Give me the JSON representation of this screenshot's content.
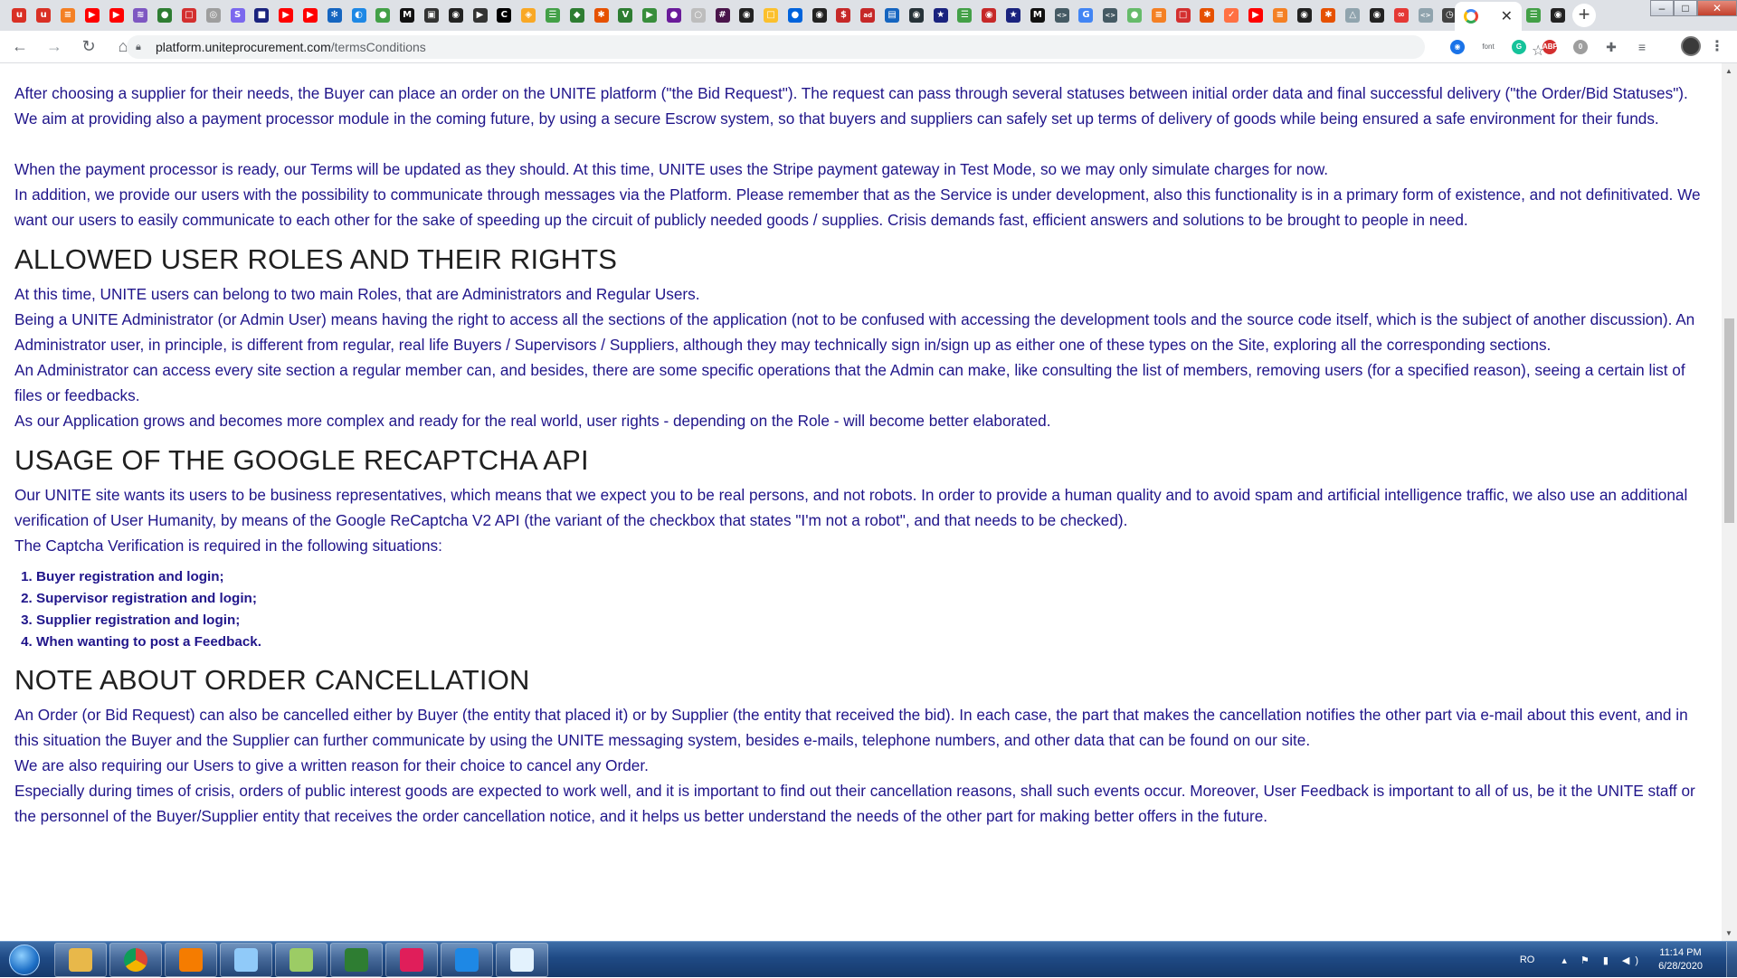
{
  "browser": {
    "pinned_tab_icons": [
      {
        "icon": "red-u-logo-icon",
        "color": "#d93025",
        "glyph": "u"
      },
      {
        "icon": "red-u-logo-icon",
        "color": "#d93025",
        "glyph": "u"
      },
      {
        "icon": "stack-overflow-icon",
        "color": "#f48024",
        "glyph": "≡"
      },
      {
        "icon": "youtube-icon",
        "color": "#ff0000",
        "glyph": "▶"
      },
      {
        "icon": "youtube-icon",
        "color": "#ff0000",
        "glyph": "▶"
      },
      {
        "icon": "purple-layers-icon",
        "color": "#7e57c2",
        "glyph": "≋"
      },
      {
        "icon": "green-leaf-icon",
        "color": "#2e7d32",
        "glyph": "●"
      },
      {
        "icon": "red-square-icon",
        "color": "#d32f2f",
        "glyph": "□"
      },
      {
        "icon": "grey-globe-icon",
        "color": "#9e9e9e",
        "glyph": "◎"
      },
      {
        "icon": "s-logo-icon",
        "color": "#7b68ee",
        "glyph": "S"
      },
      {
        "icon": "dark-square-icon",
        "color": "#1a237e",
        "glyph": "■"
      },
      {
        "icon": "youtube-icon",
        "color": "#ff0000",
        "glyph": "▶"
      },
      {
        "icon": "youtube-icon",
        "color": "#ff0000",
        "glyph": "▶"
      },
      {
        "icon": "blue-gear-icon",
        "color": "#1565c0",
        "glyph": "✻"
      },
      {
        "icon": "blue-planet-icon",
        "color": "#1e88e5",
        "glyph": "◐"
      },
      {
        "icon": "green-leaf-icon",
        "color": "#43a047",
        "glyph": "●"
      },
      {
        "icon": "medium-m-icon",
        "color": "#111111",
        "glyph": "M"
      },
      {
        "icon": "dark-box-icon",
        "color": "#333333",
        "glyph": "▣"
      },
      {
        "icon": "github-icon",
        "color": "#222222",
        "glyph": "◉"
      },
      {
        "icon": "terminal-icon",
        "color": "#333333",
        "glyph": "▶"
      },
      {
        "icon": "code-c-icon",
        "color": "#000000",
        "glyph": "C"
      },
      {
        "icon": "orange-shield-icon",
        "color": "#f9a825",
        "glyph": "◈"
      },
      {
        "icon": "green-chat-icon",
        "color": "#43a047",
        "glyph": "☰"
      },
      {
        "icon": "green-cube-icon",
        "color": "#2e7d32",
        "glyph": "◆"
      },
      {
        "icon": "orange-star-icon",
        "color": "#e65100",
        "glyph": "✱"
      },
      {
        "icon": "vue-v-icon",
        "color": "#2e7d32",
        "glyph": "V"
      },
      {
        "icon": "green-play-icon",
        "color": "#388e3c",
        "glyph": "▶"
      },
      {
        "icon": "purple-dot-icon",
        "color": "#6a1b9a",
        "glyph": "●"
      },
      {
        "icon": "grey-circle-icon",
        "color": "#bdbdbd",
        "glyph": "○"
      },
      {
        "icon": "slack-icon",
        "color": "#4a154b",
        "glyph": "#"
      },
      {
        "icon": "github-icon",
        "color": "#222222",
        "glyph": "◉"
      },
      {
        "icon": "note-icon",
        "color": "#fbc02d",
        "glyph": "□"
      },
      {
        "icon": "flickr-dots-icon",
        "color": "#0063dc",
        "glyph": "●"
      },
      {
        "icon": "github-icon",
        "color": "#222222",
        "glyph": "◉"
      },
      {
        "icon": "red-s-icon",
        "color": "#c62828",
        "glyph": "$"
      },
      {
        "icon": "ad-icon",
        "color": "#c62828",
        "glyph": "ad"
      },
      {
        "icon": "blue-flag-icon",
        "color": "#1565c0",
        "glyph": "▤"
      },
      {
        "icon": "blue-circle-icon",
        "color": "#263238",
        "glyph": "◉"
      },
      {
        "icon": "eu-flag-icon",
        "color": "#1a237e",
        "glyph": "★"
      },
      {
        "icon": "green-chat-icon",
        "color": "#43a047",
        "glyph": "☰"
      },
      {
        "icon": "red-round-icon",
        "color": "#c62828",
        "glyph": "◉"
      },
      {
        "icon": "eu-flag-icon",
        "color": "#1a237e",
        "glyph": "★"
      },
      {
        "icon": "medium-m-icon",
        "color": "#111111",
        "glyph": "M"
      },
      {
        "icon": "code-brackets-icon",
        "color": "#455a64",
        "glyph": "<>"
      },
      {
        "icon": "google-g-icon",
        "color": "#4285f4",
        "glyph": "G"
      },
      {
        "icon": "code-brackets-icon",
        "color": "#455a64",
        "glyph": "<>"
      },
      {
        "icon": "green-shield-icon",
        "color": "#66bb6a",
        "glyph": "●"
      },
      {
        "icon": "stack-overflow-icon",
        "color": "#f48024",
        "glyph": "≡"
      },
      {
        "icon": "red-square-icon",
        "color": "#d32f2f",
        "glyph": "□"
      },
      {
        "icon": "orange-star-icon",
        "color": "#e65100",
        "glyph": "✱"
      },
      {
        "icon": "orange-check-icon",
        "color": "#ff7043",
        "glyph": "✓"
      },
      {
        "icon": "youtube-icon",
        "color": "#ff0000",
        "glyph": "▶"
      },
      {
        "icon": "stack-overflow-icon",
        "color": "#f48024",
        "glyph": "≡"
      },
      {
        "icon": "github-icon",
        "color": "#222222",
        "glyph": "◉"
      },
      {
        "icon": "orange-star-icon",
        "color": "#e65100",
        "glyph": "✱"
      },
      {
        "icon": "drive-icon",
        "color": "#90a4ae",
        "glyph": "△"
      },
      {
        "icon": "github-icon",
        "color": "#222222",
        "glyph": "◉"
      },
      {
        "icon": "red-dots-icon",
        "color": "#e53935",
        "glyph": "∞"
      },
      {
        "icon": "code-brackets-icon",
        "color": "#90a4ae",
        "glyph": "<>"
      },
      {
        "icon": "clock-icon",
        "color": "#424242",
        "glyph": "◷"
      },
      {
        "icon": "speaker-icon",
        "color": "#424242",
        "glyph": "◂"
      },
      {
        "icon": "google-g-icon",
        "color": "#4285f4",
        "glyph": "G"
      }
    ],
    "active_tab": {
      "icon": "google-g-icon",
      "close_glyph": "✕"
    },
    "tabs_after_active": [
      {
        "icon": "green-chat-icon",
        "color": "#43a047",
        "glyph": "☰"
      },
      {
        "icon": "github-icon",
        "color": "#222222",
        "glyph": "◉"
      }
    ],
    "new_tab_glyph": "+",
    "window_controls": {
      "minimize": "–",
      "maximize": "□",
      "close": "✕"
    },
    "nav": {
      "back": "←",
      "forward": "→",
      "reload": "↻",
      "home": "⌂"
    },
    "url_host": "platform.uniteprocurement.com",
    "url_path": "/termsConditions",
    "star_glyph": "☆",
    "extensions": [
      {
        "icon": "blue-shield-extension-icon",
        "color": "#1a73e8",
        "glyph": "◉"
      },
      {
        "icon": "font-extension-icon",
        "color": "#ffffff",
        "glyph": "font"
      },
      {
        "icon": "grammarly-extension-icon",
        "color": "#15c39a",
        "glyph": "G"
      },
      {
        "icon": "adblock-plus-extension-icon",
        "color": "#d32f2f",
        "glyph": "ABP"
      },
      {
        "icon": "grey-badge-extension-icon",
        "color": "#9e9e9e",
        "glyph": "0"
      },
      {
        "icon": "puzzle-extension-icon",
        "color": "#5f6368",
        "glyph": "✚"
      },
      {
        "icon": "reading-list-icon",
        "color": "#5f6368",
        "glyph": "≡"
      }
    ],
    "menu_glyph": "⋮"
  },
  "page": {
    "intro_paragraph_1": "After choosing a supplier for their needs, the Buyer can place an order on the UNITE platform (\"the Bid Request\"). The request can pass through several statuses between initial order data and final successful delivery (\"the Order/Bid Statuses\"). We aim at providing also a payment processor module in the coming future, by using a secure Escrow system, so that buyers and suppliers can safely set up terms of delivery of goods while being ensured a safe environment for their funds.",
    "intro_paragraph_2": "When the payment processor is ready, our Terms will be updated as they should. At this time, UNITE uses the Stripe payment gateway in Test Mode, so we may only simulate charges for now.",
    "intro_paragraph_3": "In addition, we provide our users with the possibility to communicate through messages via the Platform. Please remember that as the Service is under development, also this functionality is in a primary form of existence, and not definitivated. We want our users to easily communicate to each other for the sake of speeding up the circuit of publicly needed goods / supplies. Crisis demands fast, efficient answers and solutions to be brought to people in need.",
    "roles_heading": "ALLOWED USER ROLES AND THEIR RIGHTS",
    "roles_paragraph_1": "At this time, UNITE users can belong to two main Roles, that are Administrators and Regular Users.",
    "roles_paragraph_2": "Being a UNITE Administrator (or Admin User) means having the right to access all the sections of the application (not to be confused with accessing the development tools and the source code itself, which is the subject of another discussion). An Administrator user, in principle, is different from regular, real life Buyers / Supervisors / Suppliers, although they may technically sign in/sign up as either one of these types on the Site, exploring all the corresponding sections.",
    "roles_paragraph_3": "An Administrator can access every site section a regular member can, and besides, there are some specific operations that the Admin can make, like consulting the list of members, removing users (for a specified reason), seeing a certain list of files or feedbacks.",
    "roles_paragraph_4": "As our Application grows and becomes more complex and ready for the real world, user rights - depending on the Role - will become better elaborated.",
    "recaptcha_heading": "USAGE OF THE GOOGLE RECAPTCHA API",
    "recaptcha_paragraph_1": "Our UNITE site wants its users to be business representatives, which means that we expect you to be real persons, and not robots. In order to provide a human quality and to avoid spam and artificial intelligence traffic, we also use an additional verification of User Humanity, by means of the Google ReCaptcha V2 API (the variant of the checkbox that states \"I'm not a robot\", and that needs to be checked).",
    "recaptcha_paragraph_2": "The Captcha Verification is required in the following situations:",
    "recaptcha_list": [
      "Buyer registration and login;",
      "Supervisor registration and login;",
      "Supplier registration and login;",
      "When wanting to post a Feedback."
    ],
    "cancellation_heading": "NOTE ABOUT ORDER CANCELLATION",
    "cancellation_paragraph_1": "An Order (or Bid Request) can also be cancelled either by Buyer (the entity that placed it) or by Supplier (the entity that received the bid). In each case, the part that makes the cancellation notifies the other part via e-mail about this event, and in this situation the Buyer and the Supplier can further communicate by using the UNITE messaging system, besides e-mails, telephone numbers, and other data that can be found on our site.",
    "cancellation_paragraph_2": "We are also requiring our Users to give a written reason for their choice to cancel any Order.",
    "cancellation_paragraph_3": "Especially during times of crisis, orders of public interest goods are expected to work well, and it is important to find out their cancellation reasons, shall such events occur. Moreover, User Feedback is important to all of us, be it the UNITE staff or the personnel of the Buyer/Supplier entity that receives the order cancellation notice, and it helps us better understand the needs of the other part for making better offers in the future.",
    "text_color": "#20158a",
    "heading_color": "#202020"
  },
  "taskbar": {
    "apps": [
      {
        "icon": "file-explorer-icon",
        "color": "#e8b84a"
      },
      {
        "icon": "chrome-icon",
        "color": "#db4437"
      },
      {
        "icon": "volume-mixer-icon",
        "color": "#f57c00"
      },
      {
        "icon": "remote-desktop-icon",
        "color": "#90caf9"
      },
      {
        "icon": "notepad-plus-icon",
        "color": "#9ccc65"
      },
      {
        "icon": "excel-icon",
        "color": "#2e7d32"
      },
      {
        "icon": "slack-icon",
        "color": "#e01e5a"
      },
      {
        "icon": "vscode-icon",
        "color": "#1e88e5"
      },
      {
        "icon": "paint-icon",
        "color": "#e3f2fd"
      }
    ],
    "language": "RO",
    "tray_icons": "▴ ⚑ ▮ ◀)",
    "time": "11:14 PM",
    "date": "6/28/2020"
  }
}
